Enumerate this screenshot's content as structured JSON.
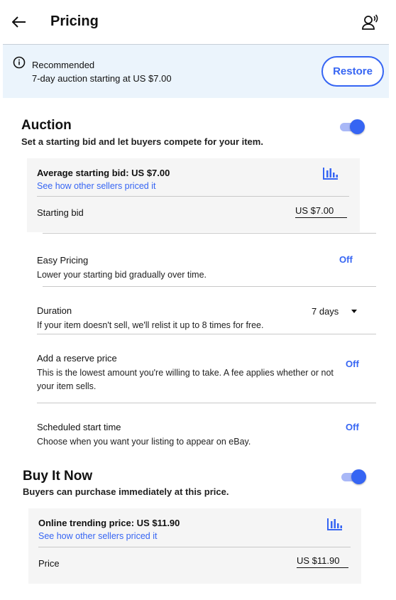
{
  "header": {
    "title": "Pricing"
  },
  "banner": {
    "title": "Recommended",
    "subtitle": "7-day auction starting at US $7.00",
    "restore_label": "Restore"
  },
  "auction": {
    "title": "Auction",
    "subtitle": "Set a starting bid and let buyers compete for your item.",
    "enabled": true,
    "avg_label": "Average starting bid: US $7.00",
    "avg_link": "See how other sellers priced it",
    "starting_bid_label": "Starting bid",
    "starting_bid_value": "US $7.00",
    "easy_pricing": {
      "label": "Easy Pricing",
      "desc": "Lower your starting bid gradually over time.",
      "value": "Off"
    },
    "duration": {
      "label": "Duration",
      "desc": "If your item doesn't sell, we'll relist it up to 8 times for free.",
      "value": "7 days"
    },
    "reserve": {
      "label": "Add a reserve price",
      "desc": "This is the lowest amount you're willing to take. A fee applies whether or not your item sells.",
      "value": "Off"
    },
    "scheduled": {
      "label": "Scheduled start time",
      "desc": "Choose when you want your listing to appear on eBay.",
      "value": "Off"
    }
  },
  "buy_it_now": {
    "title": "Buy It Now",
    "subtitle": "Buyers can purchase immediately at this price.",
    "enabled": true,
    "trend_label": "Online trending price: US $11.90",
    "trend_link": "See how other sellers priced it",
    "price_label": "Price",
    "price_value": "US $11.90"
  },
  "colors": {
    "accent": "#3665f3",
    "banner_bg": "#ebf4fc",
    "box_bg": "#f5f5f5"
  }
}
